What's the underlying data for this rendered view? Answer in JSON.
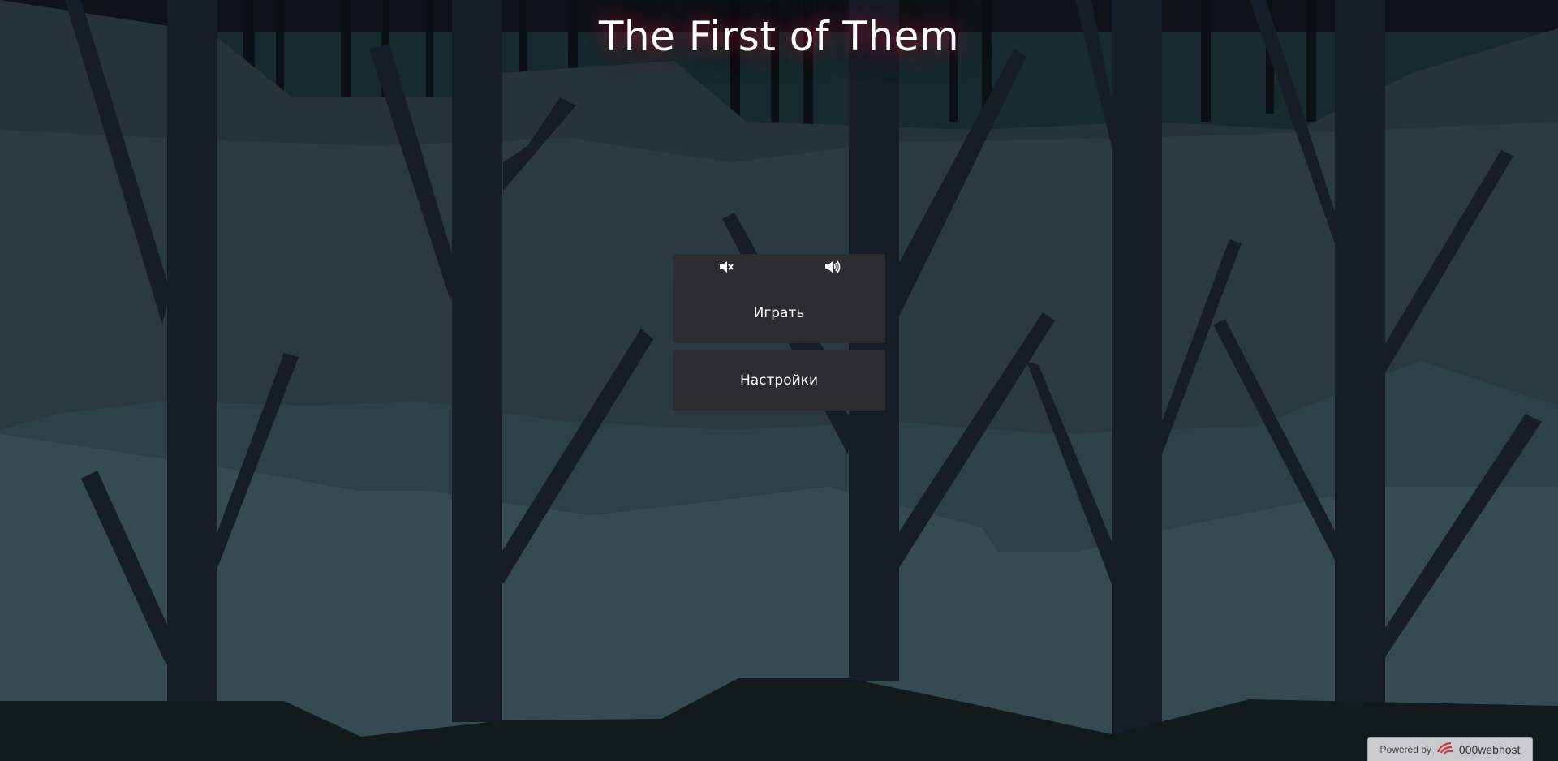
{
  "game": {
    "title": "The First of Them"
  },
  "menu": {
    "sound_off_icon": "speaker-muted-icon",
    "sound_on_icon": "speaker-volume-icon",
    "play_label": "Играть",
    "settings_label": "Настройки"
  },
  "footer": {
    "powered_by": "Powered by",
    "host_name": "000webhost",
    "host_icon": "000webhost-logo-icon"
  },
  "colors": {
    "sky": "#0d1318",
    "hills_far": "#253339",
    "hills_mid": "#2c3b42",
    "ground": "#344a51",
    "tree_trunk": "#141c25",
    "foreground": "#111a1d",
    "title_glow": "#8a1228",
    "button_bg": "#2a2c2f",
    "button_text": "#ffffff"
  }
}
